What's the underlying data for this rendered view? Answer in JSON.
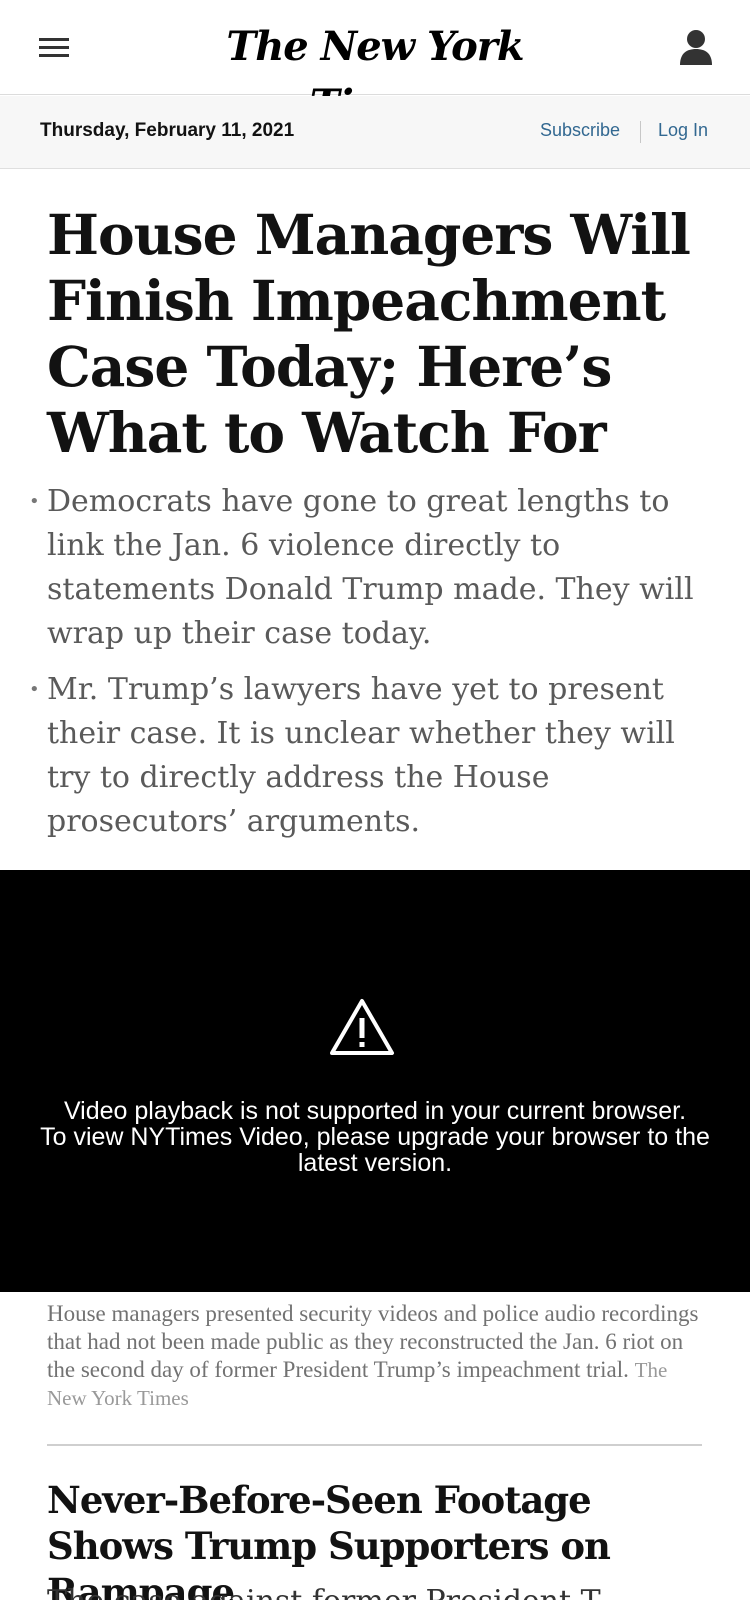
{
  "header": {
    "logo_text": "The New York Times",
    "menu_icon": "hamburger-menu-icon",
    "account_icon": "user-account-icon"
  },
  "datebar": {
    "date": "Thursday, February 11, 2021",
    "subscribe": "Subscribe",
    "login": "Log In"
  },
  "article": {
    "headline": "House Managers Will Finish Impeachment Case Today; Here’s What to Watch For",
    "summary": [
      "Democrats have gone to great lengths to link the Jan. 6 violence directly to statements Donald Trump made. They will wrap up their case today.",
      "Mr. Trump’s lawyers have yet to present their case. It is unclear whether they will try to directly address the House prosecutors’ arguments."
    ]
  },
  "video": {
    "line1": "Video playback is not supported in your current browser.",
    "line2": "To view NYTimes Video, please upgrade your browser to the latest version.",
    "icon": "warning-triangle-icon"
  },
  "caption": {
    "text": "House managers presented security videos and police audio recordings that had not been made public as they reconstructed the Jan. 6 riot on the second day of former President Trump’s impeachment trial.",
    "credit": "The New York Times"
  },
  "next_story": {
    "headline": "Never-Before-Seen Footage Shows Trump Supporters on Rampage",
    "teaser": "The case against former President T"
  },
  "colors": {
    "link": "#326891",
    "video_bg": "#000000",
    "datebar_bg": "#f7f7f7"
  }
}
